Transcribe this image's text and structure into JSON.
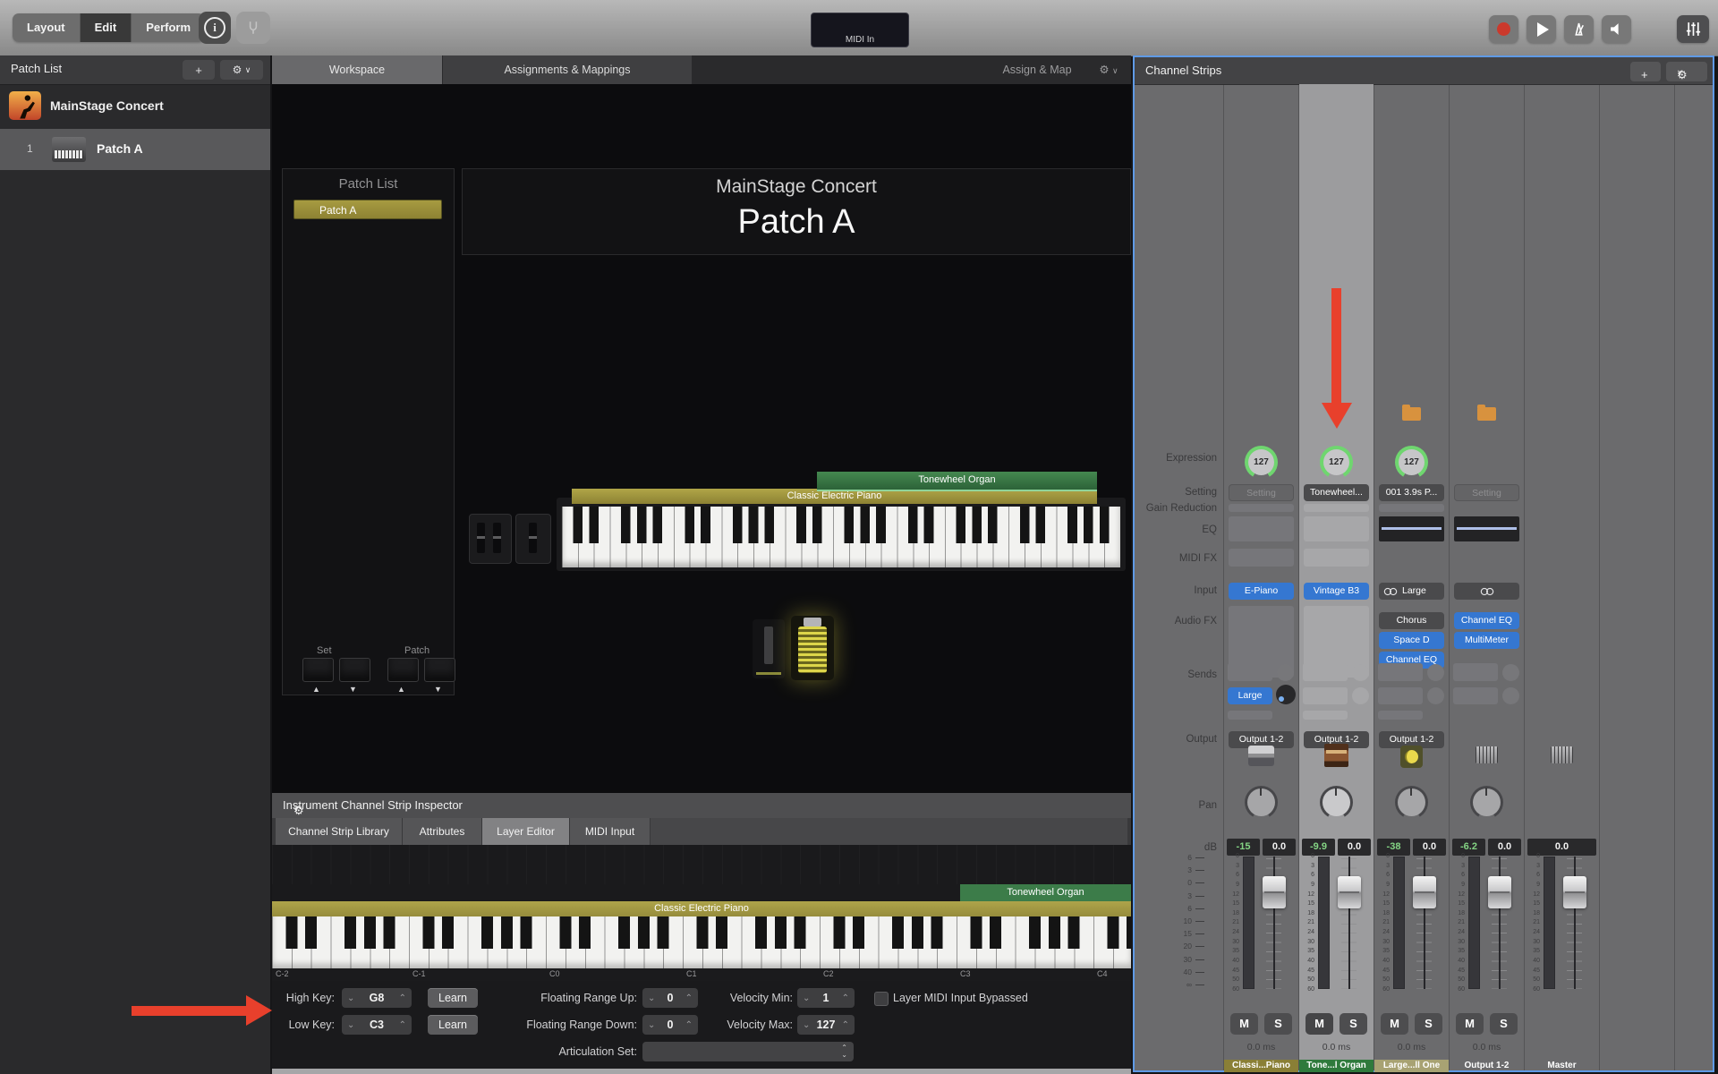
{
  "icons": {
    "add": "+",
    "gear": "⚙",
    "chevron_down": "∨",
    "stepper_down": "⌄",
    "stepper_up": "⌃",
    "arrow_up": "▲",
    "arrow_down": "▼"
  },
  "toolbar": {
    "layout": "Layout",
    "edit": "Edit",
    "perform": "Perform",
    "midi_in": "MIDI In"
  },
  "sidebar": {
    "title": "Patch List",
    "concert": "MainStage Concert",
    "patch_number": "1",
    "patch_name": "Patch A"
  },
  "center": {
    "tab_workspace": "Workspace",
    "tab_assignments": "Assignments & Mappings",
    "assign_map": "Assign & Map",
    "workspace": {
      "patch_list_title": "Patch List",
      "patch_item": "Patch A",
      "concert_title": "MainStage Concert",
      "patch_title": "Patch A",
      "organ_layer": "Tonewheel Organ",
      "piano_layer": "Classic Electric Piano",
      "set_label": "Set",
      "patch_label": "Patch"
    },
    "inspector": {
      "title": "Instrument Channel Strip Inspector",
      "tabs": [
        "Channel Strip Library",
        "Attributes",
        "Layer Editor",
        "MIDI Input"
      ],
      "organ_layer": "Tonewheel Organ",
      "piano_layer": "Classic Electric Piano",
      "octaves": [
        "C-2",
        "C-1",
        "C0",
        "C1",
        "C2",
        "C3",
        "C4"
      ],
      "high_key_label": "High Key:",
      "high_key": "G8",
      "low_key_label": "Low Key:",
      "low_key": "C3",
      "learn": "Learn",
      "floating_up_label": "Floating Range Up:",
      "floating_up": "0",
      "floating_down_label": "Floating Range Down:",
      "floating_down": "0",
      "velocity_min_label": "Velocity Min:",
      "velocity_min": "1",
      "velocity_max_label": "Velocity Max:",
      "velocity_max": "127",
      "bypass_label": "Layer MIDI Input Bypassed",
      "articulation_label": "Articulation Set:"
    }
  },
  "strips": {
    "title": "Channel Strips",
    "rows": {
      "expression": "Expression",
      "setting": "Setting",
      "gain_reduction": "Gain Reduction",
      "eq": "EQ",
      "midi_fx": "MIDI FX",
      "input": "Input",
      "audio_fx": "Audio FX",
      "sends": "Sends",
      "output": "Output",
      "pan": "Pan",
      "db": "dB"
    },
    "fader_scale": [
      "6",
      "3",
      "0",
      "3",
      "6",
      "10",
      "15",
      "20",
      "30",
      "40",
      "∞"
    ],
    "meter_scale": [
      "0",
      "3",
      "6",
      "9",
      "12",
      "15",
      "18",
      "21",
      "24",
      "30",
      "35",
      "40",
      "45",
      "50",
      "60"
    ],
    "mute": "M",
    "solo": "S",
    "latency": "0.0 ms",
    "channels": [
      {
        "name": "Classi...Piano",
        "expression": "127",
        "setting": "Setting",
        "input": "E-Piano",
        "send": "Large",
        "output": "Output 1-2",
        "pan_db": "-15",
        "gain_db": "0.0"
      },
      {
        "name": "Tone...l Organ",
        "expression": "127",
        "setting": "Tonewheel...",
        "input": "Vintage B3",
        "output": "Output 1-2",
        "pan_db": "-9.9",
        "gain_db": "0.0"
      },
      {
        "name": "Large...ll One",
        "expression": "127",
        "setting": "001 3.9s P...",
        "input": "Large",
        "fx": [
          "Chorus",
          "Space D",
          "Channel EQ"
        ],
        "output": "Output 1-2",
        "pan_db": "-38",
        "gain_db": "0.0"
      },
      {
        "name": "Output 1-2",
        "setting": "Setting",
        "fx": [
          "Channel EQ",
          "MultiMeter"
        ],
        "pan_db": "-6.2",
        "gain_db": "0.0"
      },
      {
        "name": "Master",
        "gain_db": "0.0"
      }
    ]
  },
  "colors": {
    "accent_blue": "#3577d1",
    "knob_green": "#6fd66f",
    "arrow_red": "#e8402c",
    "focus_blue": "#5f9ae6",
    "layer_olive": "#a59b43",
    "layer_green": "#3c7c49",
    "name_ch1": "#8a7f36",
    "name_ch2": "#2f7a3c",
    "name_ch3": "#a8a273"
  }
}
